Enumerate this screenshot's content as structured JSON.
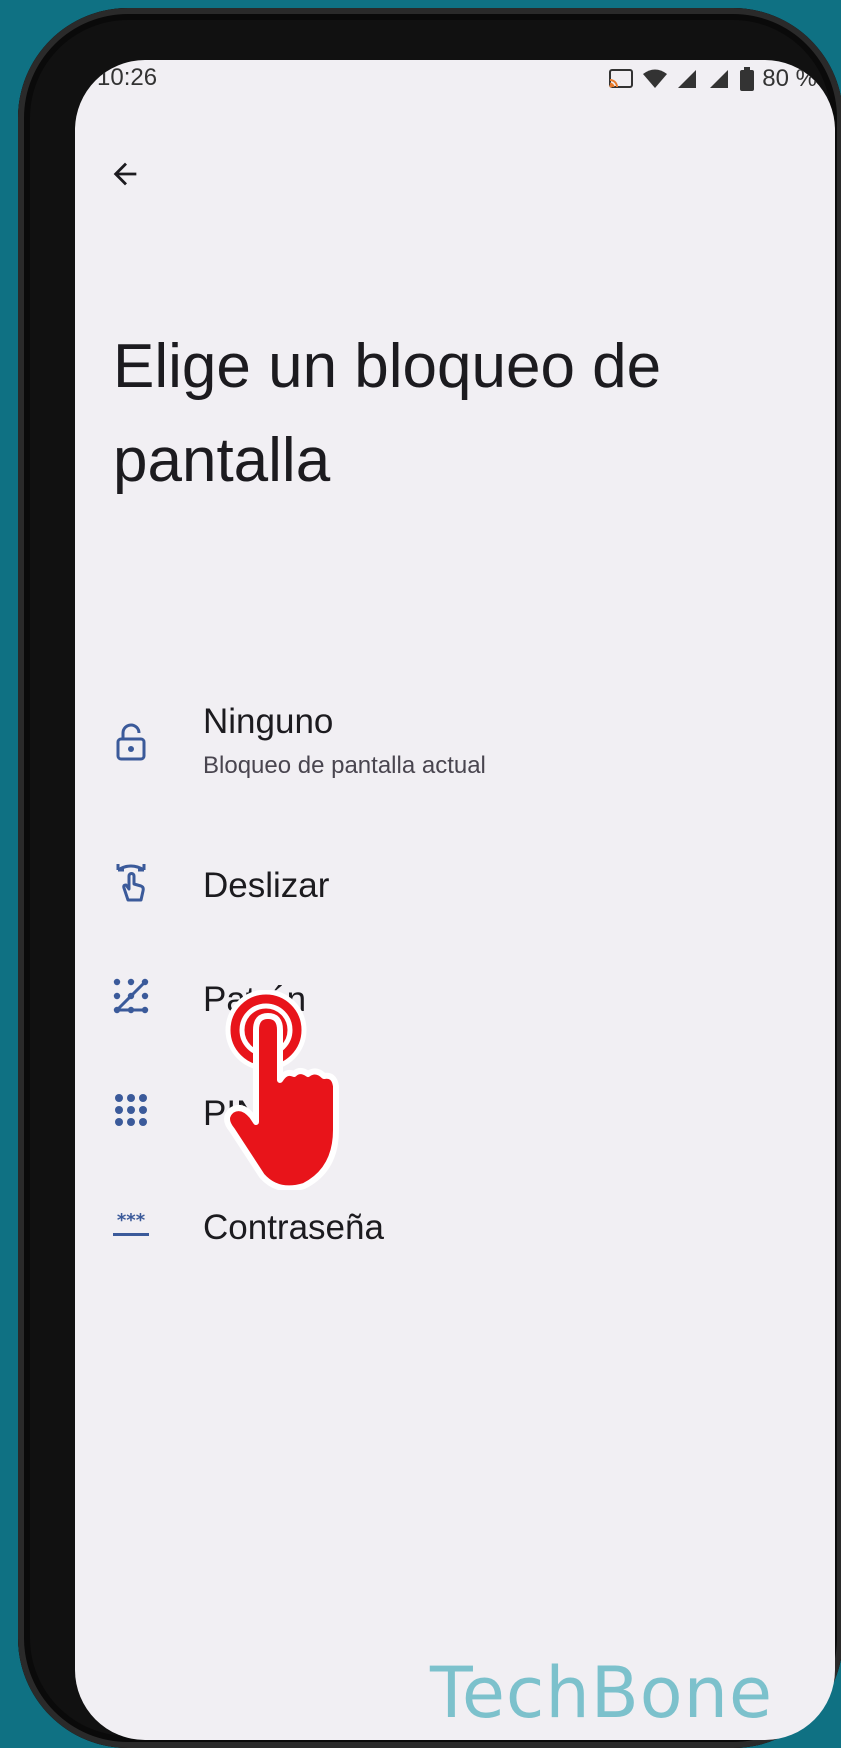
{
  "status_bar": {
    "time": "10:26",
    "battery": "80 %"
  },
  "header": {
    "back_icon": "arrow-left-icon",
    "title": "Elige un bloqueo de pantalla"
  },
  "options": [
    {
      "icon": "lock-open-icon",
      "label": "Ninguno",
      "subtitle": "Bloqueo de pantalla actual"
    },
    {
      "icon": "swipe-icon",
      "label": "Deslizar"
    },
    {
      "icon": "pattern-icon",
      "label": "Patrón"
    },
    {
      "icon": "pin-icon",
      "label": "PIN"
    },
    {
      "icon": "password-icon",
      "label": "Contraseña"
    }
  ],
  "watermark": "TechBone",
  "colors": {
    "background": "#0f7183",
    "screen": "#f1eff3",
    "icon": "#3b5a9a",
    "pointer": "#e8141a",
    "watermark": "#7cc1cc"
  }
}
